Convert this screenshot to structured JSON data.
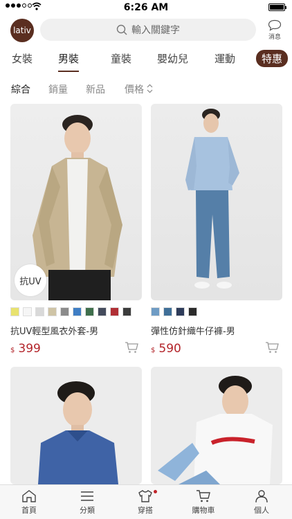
{
  "status_bar": {
    "time": "6:26 AM"
  },
  "header": {
    "logo_text": "lativ",
    "search_placeholder": "輸入關鍵字",
    "message_label": "消息"
  },
  "categories": [
    {
      "label": "女裝",
      "active": false
    },
    {
      "label": "男裝",
      "active": true
    },
    {
      "label": "童裝",
      "active": false
    },
    {
      "label": "嬰幼兒",
      "active": false
    },
    {
      "label": "運動",
      "active": false
    },
    {
      "label": "特惠",
      "active": false
    }
  ],
  "sort_options": [
    {
      "label": "綜合",
      "active": true
    },
    {
      "label": "銷量",
      "active": false
    },
    {
      "label": "新品",
      "active": false
    },
    {
      "label": "價格",
      "active": false
    }
  ],
  "products": [
    {
      "badge": "抗UV",
      "name": "抗UV輕型風衣外套-男",
      "currency": "$",
      "price": "399",
      "colors": [
        "#e8e26f",
        "#f6f6f6",
        "#d9d9d9",
        "#cfc4a6",
        "#8b8b8b",
        "#3f7ec4",
        "#3f6f4c",
        "#444b5c",
        "#b02f35",
        "#3c3c3c"
      ]
    },
    {
      "name": "彈性仿針織牛仔褲-男",
      "currency": "$",
      "price": "590",
      "colors": [
        "#6f9cc4",
        "#3f6f98",
        "#2e3c5a",
        "#2b2b2b"
      ]
    },
    {
      "name": "",
      "price": ""
    },
    {
      "name": "",
      "price": ""
    }
  ],
  "bottom_nav": [
    {
      "label": "首頁",
      "icon": "home-icon"
    },
    {
      "label": "分類",
      "icon": "menu-icon"
    },
    {
      "label": "穿搭",
      "icon": "shirt-icon"
    },
    {
      "label": "購物車",
      "icon": "cart-icon"
    },
    {
      "label": "個人",
      "icon": "person-icon"
    }
  ],
  "colors": {
    "brand": "#5a2e20",
    "price": "#b3242a",
    "dot": "#c0252b"
  }
}
